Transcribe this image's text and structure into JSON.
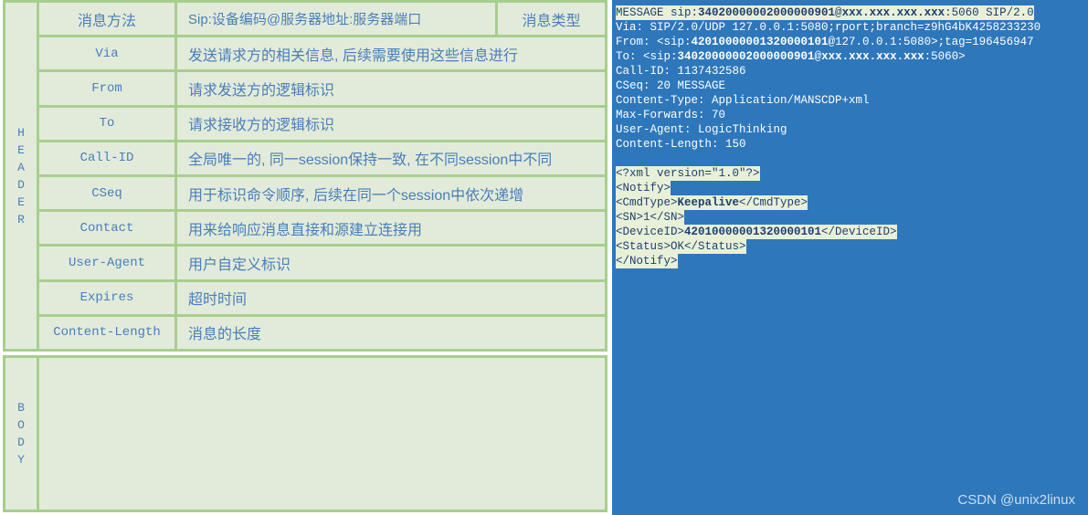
{
  "left_panel": {
    "header_section": {
      "label_letters": [
        "H",
        "E",
        "A",
        "D",
        "E",
        "R"
      ],
      "rows": [
        {
          "name": "消息方法",
          "name_is_chinese": true,
          "desc": "Sip:设备编码@服务器地址:服务器端口",
          "type": "消息类型",
          "has_type": true
        },
        {
          "name": "Via",
          "name_is_chinese": false,
          "desc": "发送请求方的相关信息, 后续需要使用这些信息进行",
          "has_type": false
        },
        {
          "name": "From",
          "name_is_chinese": false,
          "desc": "请求发送方的逻辑标识",
          "has_type": false
        },
        {
          "name": "To",
          "name_is_chinese": false,
          "desc": "请求接收方的逻辑标识",
          "has_type": false
        },
        {
          "name": "Call-ID",
          "name_is_chinese": false,
          "desc": "全局唯一的, 同一session保持一致, 在不同session中不同",
          "has_type": false
        },
        {
          "name": "CSeq",
          "name_is_chinese": false,
          "desc": "用于标识命令顺序, 后续在同一个session中依次递增",
          "has_type": false
        },
        {
          "name": "Contact",
          "name_is_chinese": false,
          "desc": "用来给响应消息直接和源建立连接用",
          "has_type": false
        },
        {
          "name": "User-Agent",
          "name_is_chinese": false,
          "desc": "用户自定义标识",
          "has_type": false
        },
        {
          "name": "Expires",
          "name_is_chinese": false,
          "desc": "超时时间",
          "has_type": false
        },
        {
          "name": "Content-Length",
          "name_is_chinese": false,
          "desc": "消息的长度",
          "has_type": false
        }
      ]
    },
    "body_section": {
      "label_letters": [
        "B",
        "O",
        "D",
        "Y"
      ],
      "content": ""
    }
  },
  "right_panel": {
    "message_lines": [
      {
        "text": "MESSAGE sip:34020000002000000901@xxx.xxx.xxx.xxx:5060 SIP/2.0",
        "highlighted": true
      },
      {
        "text": "Via: SIP/2.0/UDP 127.0.0.1:5080;rport;branch=z9hG4bK4258233230",
        "highlighted": false
      },
      {
        "text": "From: <sip:42010000001320000101@127.0.0.1:5080>;tag=196456947",
        "highlighted": false
      },
      {
        "text": "To: <sip:34020000002000000901@xxx.xxx.xxx.xxx:5060>",
        "highlighted": false
      },
      {
        "text": "Call-ID: 1137432586",
        "highlighted": false
      },
      {
        "text": "CSeq: 20 MESSAGE",
        "highlighted": false
      },
      {
        "text": "Content-Type: Application/MANSCDP+xml",
        "highlighted": false
      },
      {
        "text": "Max-Forwards: 70",
        "highlighted": false
      },
      {
        "text": "User-Agent: LogicThinking",
        "highlighted": false
      },
      {
        "text": "Content-Length: 150",
        "highlighted": false
      },
      {
        "text": "",
        "highlighted": false,
        "blank": true
      },
      {
        "text": "<?xml version=\"1.0\"?>",
        "highlighted": true
      },
      {
        "text": "<Notify>",
        "highlighted": true
      },
      {
        "text": "<CmdType>Keepalive</CmdType>",
        "highlighted": true
      },
      {
        "text": "<SN>1</SN>",
        "highlighted": true
      },
      {
        "text": "<DeviceID>42010000001320000101</DeviceID>",
        "highlighted": true
      },
      {
        "text": "<Status>OK</Status>",
        "highlighted": true
      },
      {
        "text": "</Notify>",
        "highlighted": true
      }
    ]
  },
  "watermark": {
    "text": "CSDN @unix2linux"
  },
  "colors": {
    "table_cell_bg": "#e2ebd9",
    "table_border": "#a8ce8f",
    "table_text": "#4a7ebb",
    "panel_bg": "#2e77bb",
    "highlight_bg": "#e8f0d8",
    "highlight_text": "#1f3f70",
    "message_text": "#ffffff"
  }
}
